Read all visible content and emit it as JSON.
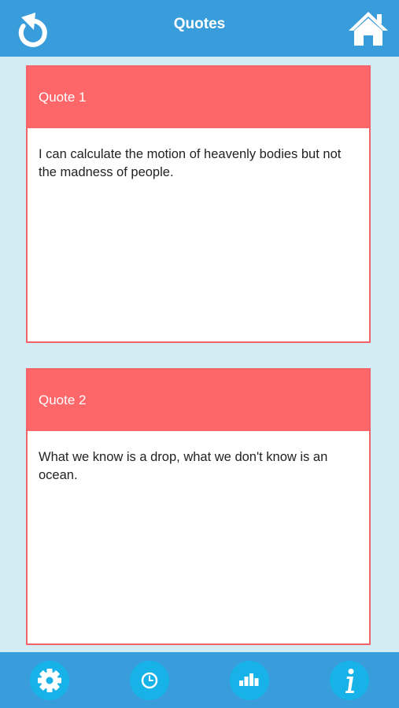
{
  "header": {
    "title": "Quotes",
    "back_icon": "back-arrow-icon",
    "home_icon": "home-icon"
  },
  "quotes": [
    {
      "label": "Quote 1",
      "text": "I can calculate the motion of heavenly bodies but not the madness of people."
    },
    {
      "label": "Quote 2",
      "text": "What we know is a drop, what we don't know is an ocean."
    }
  ],
  "footer": {
    "tabs": [
      {
        "icon": "gear-icon"
      },
      {
        "icon": "clock-icon"
      },
      {
        "icon": "bar-chart-icon"
      },
      {
        "icon": "info-icon"
      }
    ]
  },
  "colors": {
    "header_bg": "#3a9ddb",
    "page_bg": "#d3ecf4",
    "card_header_bg": "#fd6769",
    "card_border": "#f06468",
    "tab_circle": "#16b2e8"
  }
}
